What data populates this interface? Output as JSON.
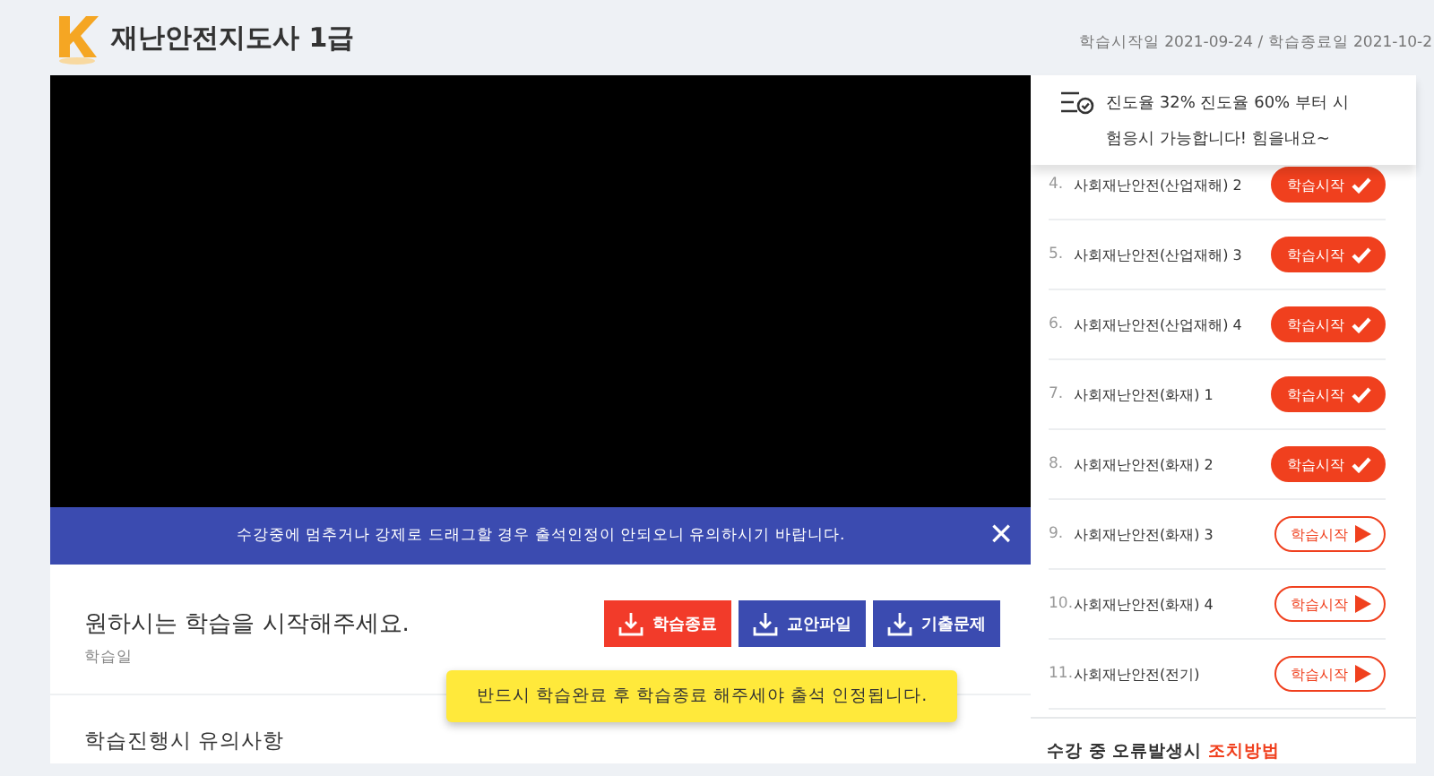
{
  "header": {
    "title": "재난안전지도사 1급",
    "dates": "학습시작일   2021-09-24 / 학습종료일   2021-10-2"
  },
  "notice_banner": {
    "text": "수강중에 멈추거나 강제로 드래그할 경우 출석인정이 안되오니 유의하시기 바랍니다.",
    "close": "×"
  },
  "lesson": {
    "heading": "원하시는 학습을 시작해주세요.",
    "subtitle": "학습일",
    "buttons": [
      {
        "label": "학습종료",
        "kind": "end"
      },
      {
        "label": "교안파일",
        "kind": "file"
      },
      {
        "label": "기출문제",
        "kind": "file"
      }
    ],
    "tooltip": "반드시 학습완료 후 학습종료 해주세야 출석 인정됩니다."
  },
  "guide_heading": "학습진행시 유의사항",
  "progress_notice": "진도율 32% 진도율 60% 부터 시험응시 가능합니다! 힘을내요~",
  "chapters": [
    {
      "number": "4.",
      "title": "사회재난안전(산업재해) 2",
      "button": "학습시작",
      "done": true
    },
    {
      "number": "5.",
      "title": "사회재난안전(산업재해) 3",
      "button": "학습시작",
      "done": true
    },
    {
      "number": "6.",
      "title": "사회재난안전(산업재해) 4",
      "button": "학습시작",
      "done": true
    },
    {
      "number": "7.",
      "title": "사회재난안전(화재) 1",
      "button": "학습시작",
      "done": true
    },
    {
      "number": "8.",
      "title": "사회재난안전(화재) 2",
      "button": "학습시작",
      "done": true
    },
    {
      "number": "9.",
      "title": "사회재난안전(화재) 3",
      "button": "학습시작",
      "done": false
    },
    {
      "number": "10.",
      "title": "사회재난안전(화재) 4",
      "button": "학습시작",
      "done": false
    },
    {
      "number": "11.",
      "title": "사회재난안전(전기)",
      "button": "학습시작",
      "done": false
    }
  ],
  "error_help": "수강 중 오류발생시 **조치방법**"
}
